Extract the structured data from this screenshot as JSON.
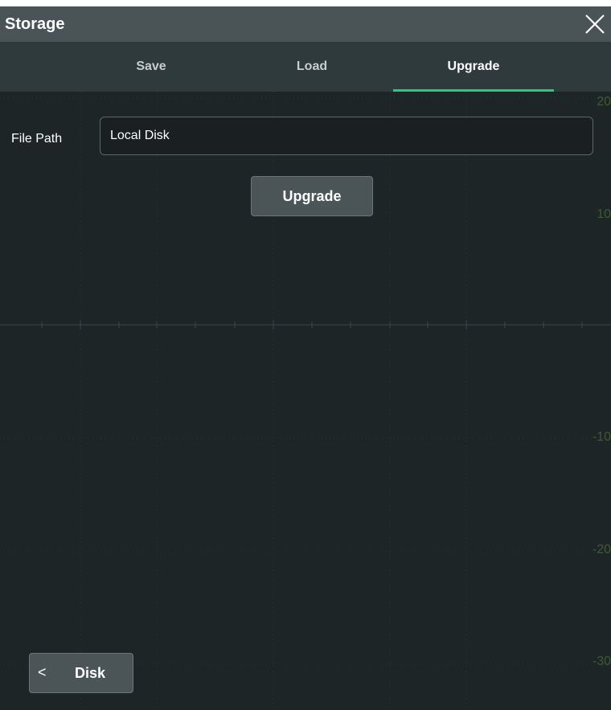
{
  "window": {
    "title": "Storage",
    "close_icon": "close-icon"
  },
  "tabs": [
    {
      "label": "Save",
      "active": false
    },
    {
      "label": "Load",
      "active": false
    },
    {
      "label": "Upgrade",
      "active": true
    }
  ],
  "form": {
    "file_path_label": "File Path",
    "file_path_value": "Local Disk",
    "upgrade_button": "Upgrade"
  },
  "footer": {
    "disk_chevron": "<",
    "disk_label": "Disk"
  },
  "background_scale": [
    "20",
    "10",
    "-10",
    "-20",
    "-30"
  ],
  "colors": {
    "background": "#1e2527",
    "titlebar": "#4a5457",
    "tabbar": "#2f3a3d",
    "accent": "#2dc97a"
  }
}
